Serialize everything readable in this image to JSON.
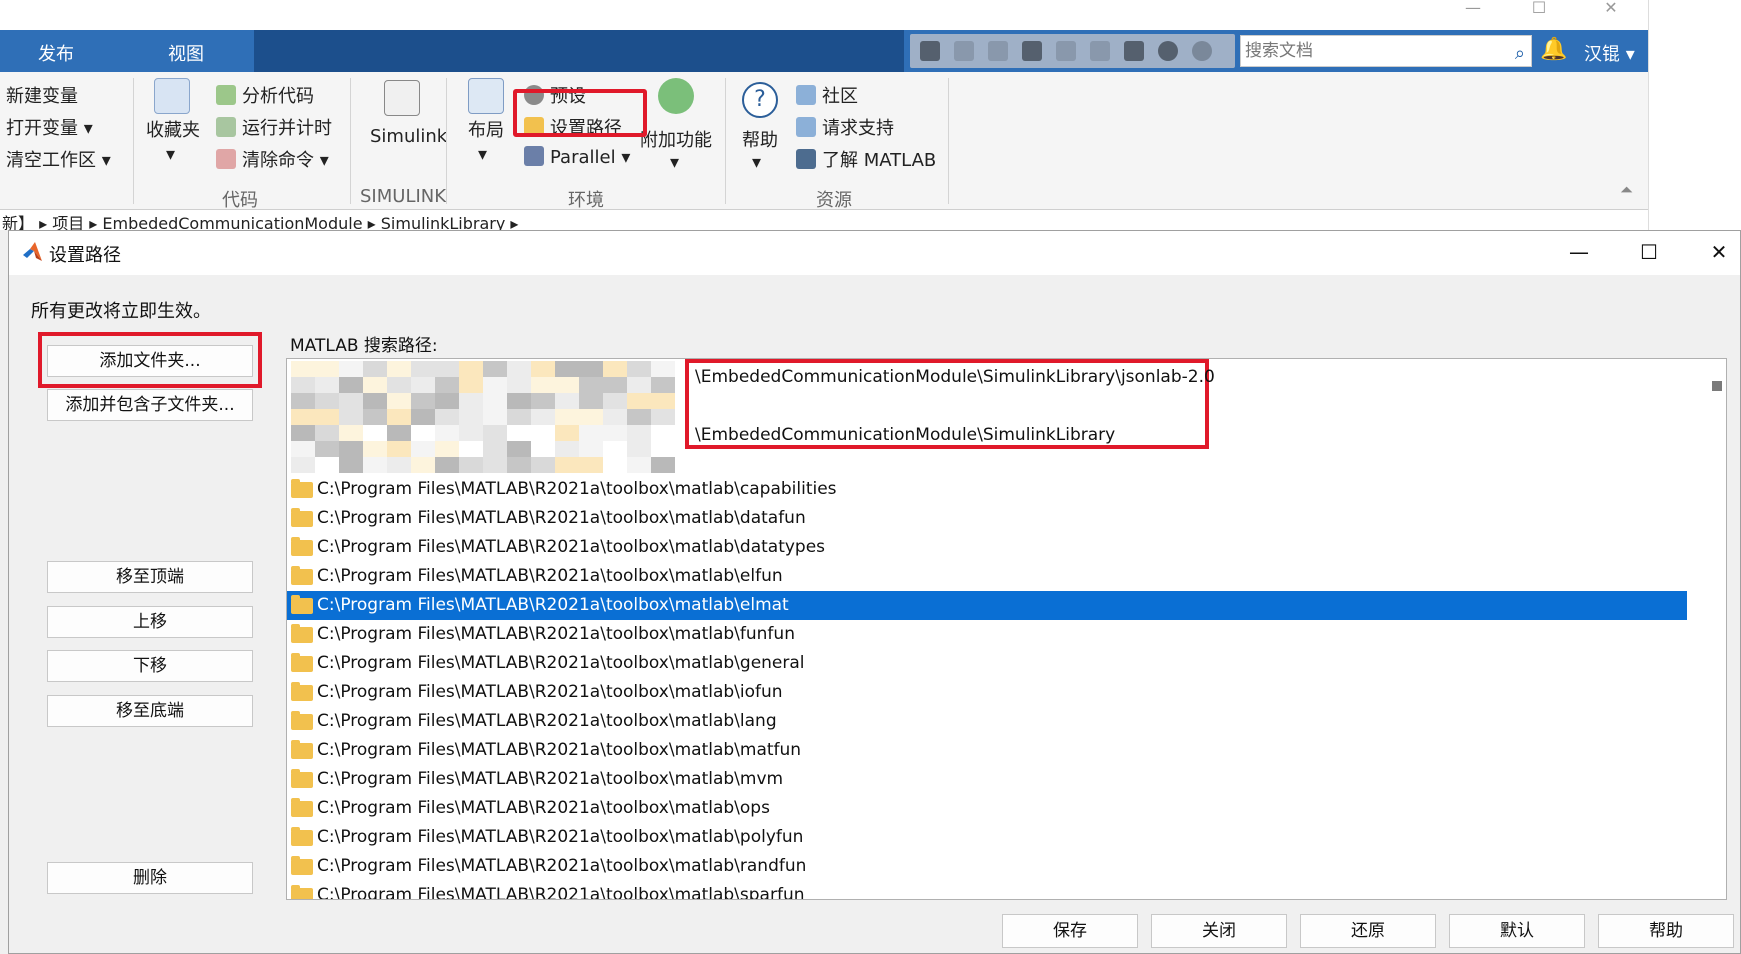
{
  "matlab": {
    "tabs": [
      "发布",
      "视图"
    ],
    "search_placeholder": "搜索文档",
    "user": "汉锟",
    "ribbon": {
      "new_variable": "新建变量",
      "open_variable": "打开变量",
      "clear_workspace": "清空工作区",
      "favorites": "收藏夹",
      "analyze_code": "分析代码",
      "run_and_time": "运行并计时",
      "clear_commands": "清除命令",
      "group_code": "代码",
      "simulink": "Simulink",
      "group_simulink": "SIMULINK",
      "layout": "布局",
      "preferences": "预设",
      "set_path": "设置路径",
      "parallel": "Parallel",
      "addons": "附加功能",
      "group_environment": "环境",
      "help": "帮助",
      "community": "社区",
      "request_support": "请求支持",
      "learn_matlab": "了解 MATLAB",
      "group_resources": "资源"
    },
    "address_bar": "新】 ▸ 项目 ▸ EmbededCommunicationModule ▸ SimulinkLibrary ▸"
  },
  "dialog": {
    "title": "设置路径",
    "info": "所有更改将立即生效。",
    "buttons": {
      "add_folder": "添加文件夹...",
      "add_with_subfolders": "添加并包含子文件夹...",
      "move_to_top": "移至顶端",
      "move_up": "上移",
      "move_down": "下移",
      "move_to_bottom": "移至底端",
      "remove": "删除"
    },
    "path_label": "MATLAB 搜索路径:",
    "custom_paths": [
      "\\EmbededCommunicationModule\\SimulinkLibrary\\jsonlab-2.0",
      "\\EmbededCommunicationModule\\SimulinkLibrary"
    ],
    "paths": [
      "C:\\Program Files\\MATLAB\\R2021a\\toolbox\\matlab\\capabilities",
      "C:\\Program Files\\MATLAB\\R2021a\\toolbox\\matlab\\datafun",
      "C:\\Program Files\\MATLAB\\R2021a\\toolbox\\matlab\\datatypes",
      "C:\\Program Files\\MATLAB\\R2021a\\toolbox\\matlab\\elfun",
      "C:\\Program Files\\MATLAB\\R2021a\\toolbox\\matlab\\elmat",
      "C:\\Program Files\\MATLAB\\R2021a\\toolbox\\matlab\\funfun",
      "C:\\Program Files\\MATLAB\\R2021a\\toolbox\\matlab\\general",
      "C:\\Program Files\\MATLAB\\R2021a\\toolbox\\matlab\\iofun",
      "C:\\Program Files\\MATLAB\\R2021a\\toolbox\\matlab\\lang",
      "C:\\Program Files\\MATLAB\\R2021a\\toolbox\\matlab\\matfun",
      "C:\\Program Files\\MATLAB\\R2021a\\toolbox\\matlab\\mvm",
      "C:\\Program Files\\MATLAB\\R2021a\\toolbox\\matlab\\ops",
      "C:\\Program Files\\MATLAB\\R2021a\\toolbox\\matlab\\polyfun",
      "C:\\Program Files\\MATLAB\\R2021a\\toolbox\\matlab\\randfun",
      "C:\\Program Files\\MATLAB\\R2021a\\toolbox\\matlab\\sparfun"
    ],
    "selected_path": "C:\\Program Files\\MATLAB\\R2021a\\toolbox\\matlab\\elmat",
    "bottom_buttons": {
      "save": "保存",
      "close": "关闭",
      "revert": "还原",
      "default": "默认",
      "help": "帮助"
    }
  },
  "colors": {
    "tab_bar": "#2f6fb7",
    "selection": "#0a6fd4",
    "highlight_box": "#e0192a",
    "folder": "#f2c14e"
  }
}
